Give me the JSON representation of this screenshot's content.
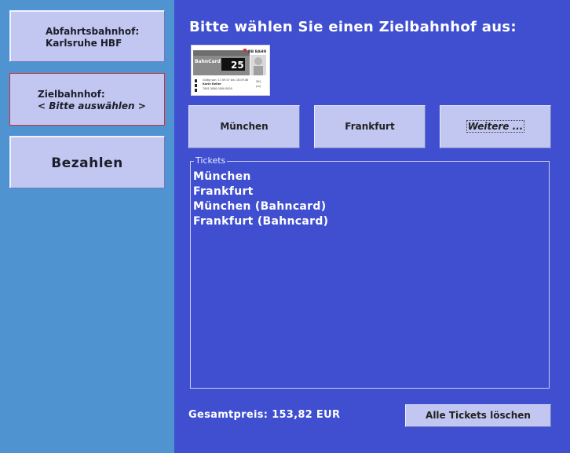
{
  "sidebar": {
    "origin": {
      "title": "Abfahrtsbahnhof:",
      "value": "Karlsruhe HBF"
    },
    "destination": {
      "title": "Zielbahnhof:",
      "value": "< Bitte auswählen >"
    },
    "pay_label": "Bezahlen"
  },
  "main": {
    "title": "Bitte wählen Sie einen Zielbahnhof aus:",
    "bahncard": {
      "label": "BahnCard",
      "number": "25",
      "brand": "DB BAHN",
      "valid_line": "Gültig von: 17.09.07 bis: 16.09.08",
      "name": "Karin Keller",
      "card_number": "7081 0000 0000 0000",
      "class_lines": [
        "2KL",
        "(m)"
      ]
    },
    "destinations": [
      "München",
      "Frankfurt",
      "Weitere ..."
    ],
    "tickets_legend": "Tickets",
    "tickets": [
      "München",
      "Frankfurt",
      "München (Bahncard)",
      "Frankfurt (Bahncard)"
    ],
    "total": "Gesamtpreis: 153,82 EUR",
    "clear_label": "Alle Tickets löschen"
  },
  "colors": {
    "sidebar_bg": "#4f94d0",
    "main_bg": "#3f4fcf",
    "button_bg": "#c2c7f1",
    "selected_border": "#d0313a",
    "text_white": "#ffffff"
  }
}
